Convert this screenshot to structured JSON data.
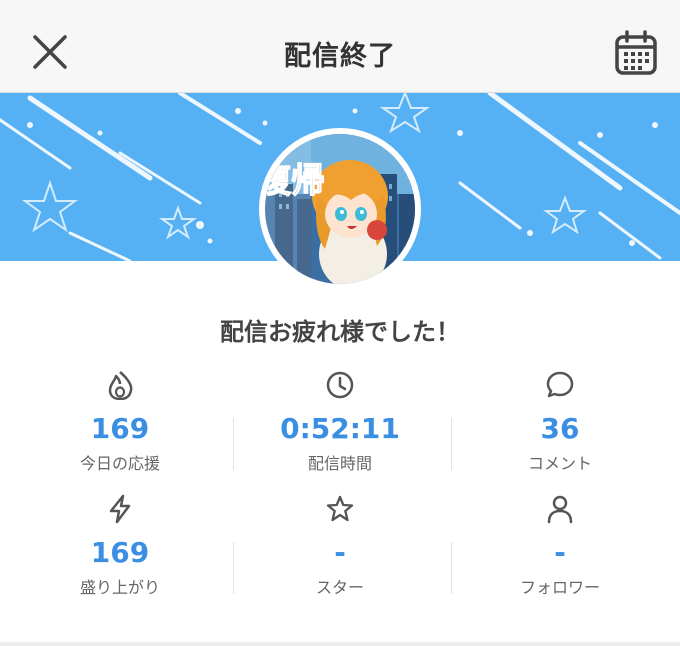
{
  "header": {
    "title": "配信終了",
    "close_icon": "close-icon",
    "calendar_icon": "calendar-icon"
  },
  "banner": {
    "background_color": "#55b0f4",
    "avatar_text": "復帰"
  },
  "message": "配信お疲れ様でした！",
  "accent_color": "#3b8fe3",
  "stats": [
    {
      "icon": "flame-icon",
      "value": "169",
      "label": "今日の応援"
    },
    {
      "icon": "clock-icon",
      "value": "0:52:11",
      "label": "配信時間"
    },
    {
      "icon": "comment-icon",
      "value": "36",
      "label": "コメント"
    },
    {
      "icon": "lightning-icon",
      "value": "169",
      "label": "盛り上がり"
    },
    {
      "icon": "star-icon",
      "value": "-",
      "label": "スター"
    },
    {
      "icon": "person-icon",
      "value": "-",
      "label": "フォロワー"
    }
  ]
}
